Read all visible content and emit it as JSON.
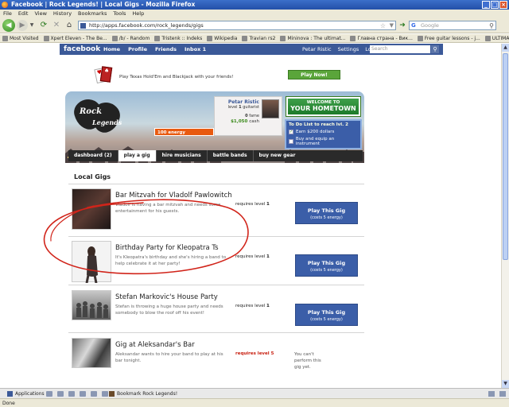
{
  "window": {
    "title": "Facebook | Rock Legends! | Local Gigs - Mozilla Firefox"
  },
  "menu": [
    "File",
    "Edit",
    "View",
    "History",
    "Bookmarks",
    "Tools",
    "Help"
  ],
  "nav": {
    "url": "http://apps.facebook.com/rock_legends/gigs",
    "search_placeholder": "Google"
  },
  "bookmarks": [
    "Most Visited",
    "Xpert Eleven - The Be...",
    "/b/ - Random",
    "Tristenk :: Indeks",
    "Wikipedia",
    "Travian rs2",
    "Mininova : The ultimat...",
    "Главна страна - Вик...",
    "Free guitar lessons - j...",
    "ULTIMATE GUITAR TA..."
  ],
  "facebook": {
    "logo": "facebook",
    "nav": [
      "Home",
      "Profile",
      "Friends",
      "Inbox"
    ],
    "inbox_count": "1",
    "right": [
      "Petar Ristic",
      "Settings",
      "Logout"
    ],
    "search_placeholder": "Search"
  },
  "ad": {
    "text": "Play Texas Hold'Em and Blackjack with your friends!",
    "button": "Play Now!"
  },
  "game": {
    "logo_top": "Rock",
    "logo_bottom": "Legends",
    "player_name": "Petar Ristic",
    "level_prefix": "level",
    "level_value": "1",
    "level_suffix": "guitarist",
    "fame_value": "0",
    "fame_label": "fame",
    "cash_value": "$1,050",
    "cash_label": "cash",
    "energy": "100 energy",
    "hometown_l1": "WELCOME TO",
    "hometown_l2": "YOUR HOMETOWN",
    "todo_title": "To Do List",
    "todo_reach": "to reach lvl. 2",
    "todo_items": [
      {
        "text": "Earn $200 dollars",
        "done": true
      },
      {
        "text": "Buy and equip an instrument",
        "done": false
      }
    ]
  },
  "tabs": [
    {
      "label": "dashboard (2)",
      "active": false
    },
    {
      "label": "play a gig",
      "active": true
    },
    {
      "label": "hire musicians",
      "active": false
    },
    {
      "label": "battle bands",
      "active": false
    },
    {
      "label": "buy new gear",
      "active": false
    }
  ],
  "section_title": "Local Gigs",
  "requires_label": "requires level",
  "play_label": "Play This Gig",
  "cost_label": "(costs 5 energy)",
  "gigs": [
    {
      "title": "Bar Mitzvah for Vladolf Pawlowitch",
      "desc": "Vladolf is having a bar mitzvah and needs some entertainment for his guests.",
      "level": "1",
      "can_play": true
    },
    {
      "title": "Birthday Party for Kleopatra Ts",
      "desc": "It's Kleopatra's birthday and she's hiring a band to help celebrate it at her party!",
      "level": "1",
      "can_play": true
    },
    {
      "title": "Stefan Markovic's House Party",
      "desc": "Stefan is throwing a huge house party and needs somebody to blow the roof off his event!",
      "level": "1",
      "can_play": true
    },
    {
      "title": "Gig at Aleksandar's Bar",
      "desc": "Aleksandar wants to hire your band to play at his bar tonight.",
      "level": "5",
      "can_play": false,
      "cant_text": "You can't perform this gig yet."
    }
  ],
  "footer": {
    "applications": "Applications",
    "bookmark": "Bookmark Rock Legends!"
  },
  "status": "Done",
  "colors": {
    "facebook_blue": "#3b5998",
    "accent_green": "#5aa53a",
    "energy_orange": "#e85a10",
    "scribble_red": "#d1241a"
  }
}
